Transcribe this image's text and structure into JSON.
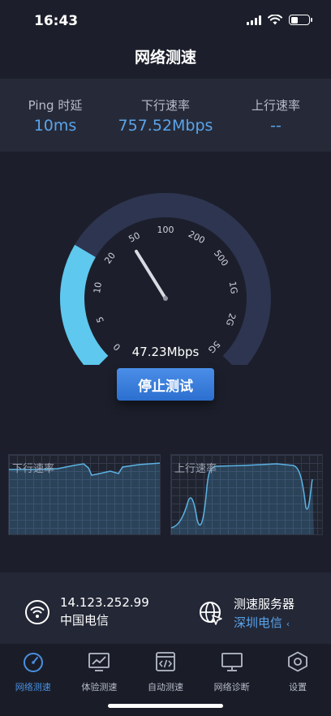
{
  "status": {
    "time": "16:43"
  },
  "title": "网络测速",
  "stats": {
    "ping_label": "Ping 时延",
    "ping_value": "10ms",
    "down_label": "下行速率",
    "down_value": "757.52Mbps",
    "up_label": "上行速率",
    "up_value": "--"
  },
  "gauge": {
    "ticks": [
      "0",
      "5",
      "10",
      "20",
      "50",
      "100",
      "200",
      "500",
      "1G",
      "2G",
      "5G"
    ],
    "progress_fraction": 0.28,
    "current_speed": "47.23Mbps"
  },
  "stop_button": "停止测试",
  "graphs": {
    "down_label": "下行速率",
    "up_label": "上行速率"
  },
  "info": {
    "ip": "14.123.252.99",
    "isp": "中国电信",
    "server_label": "测速服务器",
    "server_name": "深圳电信"
  },
  "tabs": [
    {
      "label": "网络测速",
      "active": true
    },
    {
      "label": "体验测速"
    },
    {
      "label": "自动测速"
    },
    {
      "label": "网络诊断"
    },
    {
      "label": "设置"
    }
  ],
  "colors": {
    "accent": "#4a90e2",
    "gauge_progress": "#5ec8ee",
    "gauge_track": "#2e3550",
    "background": "#1c1f2b"
  }
}
